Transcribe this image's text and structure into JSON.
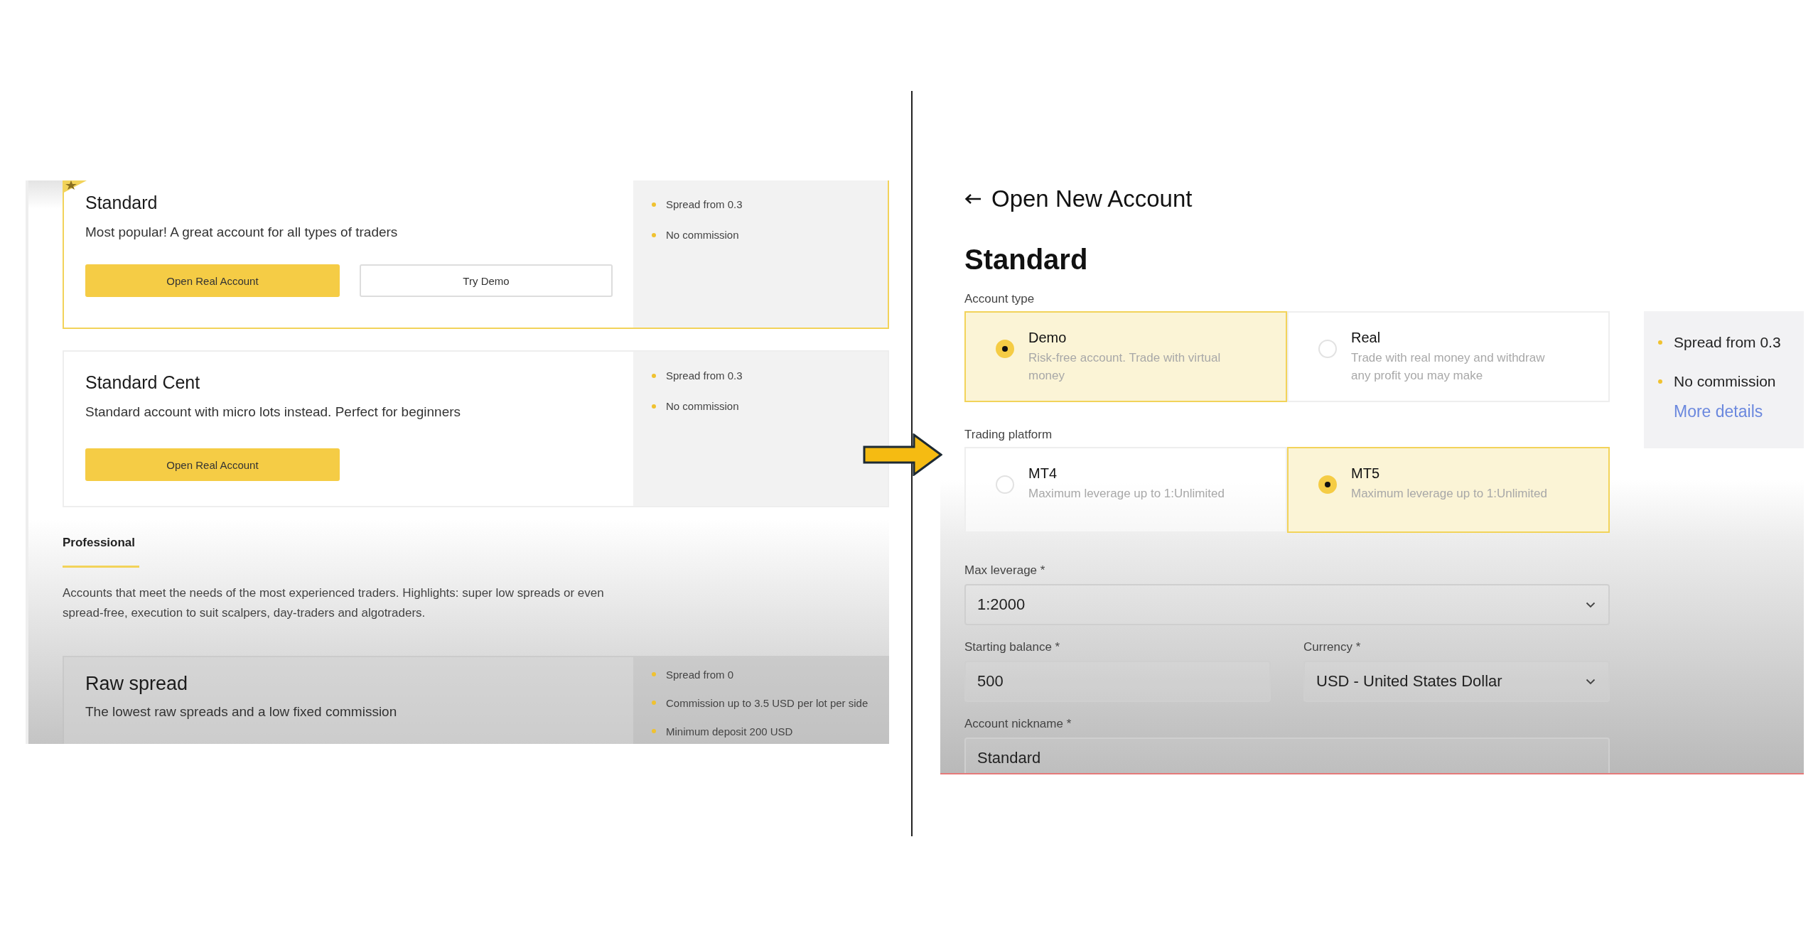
{
  "account_list": {
    "cards": [
      {
        "title": "Standard",
        "description": "Most popular! A great account for all types of traders",
        "featured": true,
        "buttons": [
          {
            "label": "Open Real Account",
            "kind": "primary"
          },
          {
            "label": "Try Demo",
            "kind": "secondary"
          }
        ],
        "features": [
          "Spread from 0.3",
          "No commission"
        ]
      },
      {
        "title": "Standard Cent",
        "description": "Standard account with micro lots instead. Perfect for beginners",
        "featured": false,
        "buttons": [
          {
            "label": "Open Real Account",
            "kind": "primary"
          }
        ],
        "features": [
          "Spread from 0.3",
          "No commission"
        ]
      }
    ],
    "section": {
      "tab": "Professional",
      "description": "Accounts that meet the needs of the most experienced traders. Highlights: super low spreads or even spread-free, execution to suit scalpers, day-traders and algotraders."
    },
    "pro_cards": [
      {
        "title": "Raw spread",
        "description": "The lowest raw spreads and a low fixed commission",
        "features": [
          "Spread from 0",
          "Commission up to 3.5 USD per lot per side",
          "Minimum deposit 200 USD"
        ]
      }
    ]
  },
  "open_account": {
    "title": "Open New Account",
    "account_name": "Standard",
    "groups": [
      {
        "label": "Account type",
        "options": [
          {
            "title": "Demo",
            "description": "Risk-free account. Trade with virtual money",
            "selected": true
          },
          {
            "title": "Real",
            "description": "Trade with real money and withdraw any profit you may make",
            "selected": false
          }
        ]
      },
      {
        "label": "Trading platform",
        "options": [
          {
            "title": "MT4",
            "description": "Maximum leverage up to 1:Unlimited",
            "selected": false
          },
          {
            "title": "MT5",
            "description": "Maximum leverage up to 1:Unlimited",
            "selected": true
          }
        ]
      }
    ],
    "summary": {
      "features": [
        "Spread from 0.3",
        "No commission"
      ],
      "link": "More details"
    },
    "field_rows": [
      [
        {
          "label": "Max leverage *",
          "value": "1:2000",
          "kind": "select"
        }
      ],
      [
        {
          "label": "Starting balance *",
          "value": "500",
          "kind": "text"
        },
        {
          "label": "Currency *",
          "value": "USD - United States Dollar",
          "kind": "select"
        }
      ],
      [
        {
          "label": "Account nickname *",
          "value": "Standard",
          "kind": "text"
        }
      ]
    ]
  }
}
